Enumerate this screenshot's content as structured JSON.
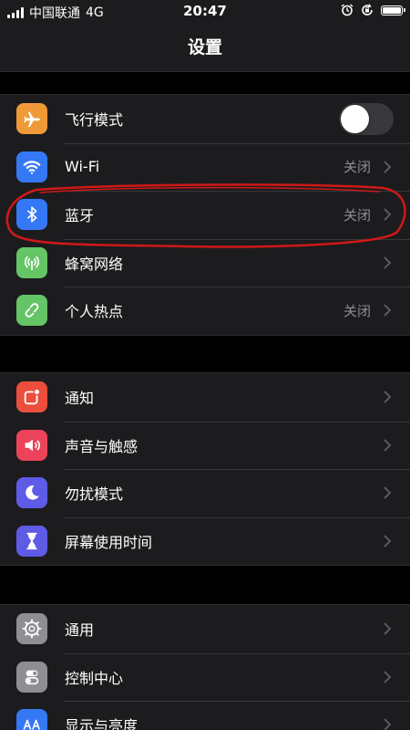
{
  "status_bar": {
    "carrier": "中国联通",
    "network": "4G",
    "time": "20:47"
  },
  "nav": {
    "title": "设置"
  },
  "groups": [
    {
      "items": [
        {
          "label": "飞行模式",
          "icon": "airplane-icon",
          "color": "#f09a37",
          "toggle": false
        },
        {
          "label": "Wi-Fi",
          "icon": "wifi-icon",
          "color": "#3478f6",
          "value": "关闭"
        },
        {
          "label": "蓝牙",
          "icon": "bluetooth-icon",
          "color": "#3478f6",
          "value": "关闭"
        },
        {
          "label": "蜂窝网络",
          "icon": "cellular-icon",
          "color": "#65c466"
        },
        {
          "label": "个人热点",
          "icon": "hotspot-icon",
          "color": "#65c466",
          "value": "关闭"
        }
      ]
    },
    {
      "items": [
        {
          "label": "通知",
          "icon": "notifications-icon",
          "color": "#eb4e3d"
        },
        {
          "label": "声音与触感",
          "icon": "sound-icon",
          "color": "#eb445a"
        },
        {
          "label": "勿扰模式",
          "icon": "moon-icon",
          "color": "#5e5ce6"
        },
        {
          "label": "屏幕使用时间",
          "icon": "hourglass-icon",
          "color": "#5e5ce6"
        }
      ]
    },
    {
      "items": [
        {
          "label": "通用",
          "icon": "gear-icon",
          "color": "#8e8e93"
        },
        {
          "label": "控制中心",
          "icon": "switches-icon",
          "color": "#8e8e93"
        },
        {
          "label": "显示与亮度",
          "icon": "display-icon",
          "color": "#3478f6"
        }
      ]
    }
  ]
}
